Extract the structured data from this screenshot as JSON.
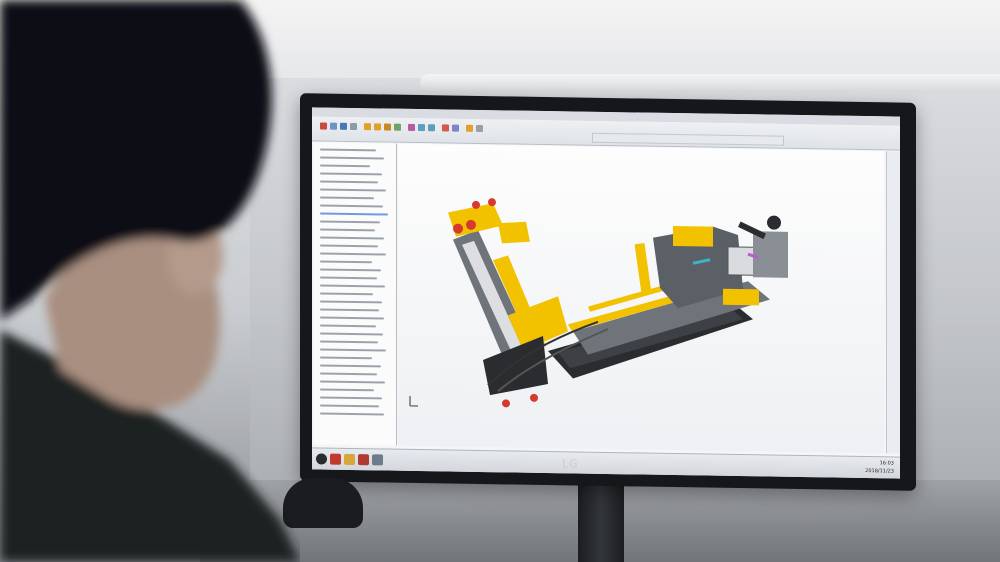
{
  "monitor": {
    "brand": "LG"
  },
  "cad": {
    "taskbar": {
      "time": "16:03",
      "date": "2018/11/23"
    }
  },
  "colors": {
    "machine_yellow": "#f2c200",
    "machine_gray": "#6f747a",
    "machine_dark": "#2a2c2f",
    "accent_red": "#d63a2f",
    "selection_blue": "#6d9be0"
  }
}
